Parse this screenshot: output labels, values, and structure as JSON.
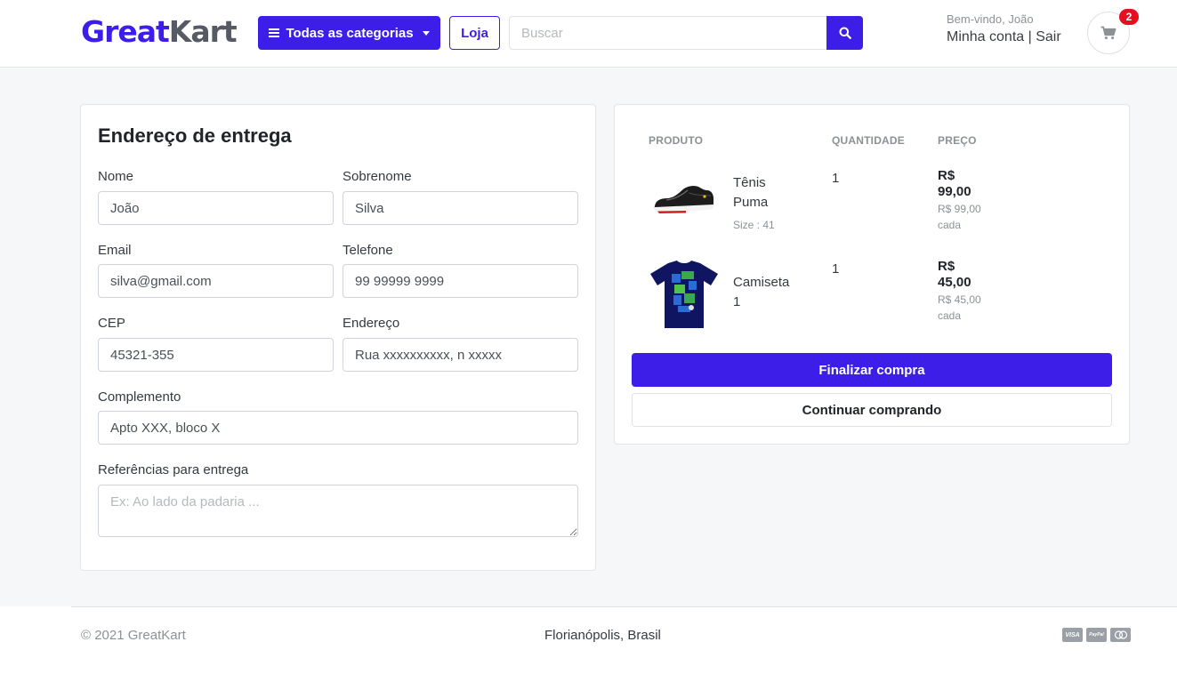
{
  "header": {
    "logo_part1": "Great",
    "logo_part2": "Kart",
    "categories_label": "Todas as categorias",
    "store_label": "Loja",
    "search_placeholder": "Buscar",
    "welcome_text": "Bem-vindo, João",
    "my_account_label": "Minha conta",
    "separator": "|",
    "logout_label": "Sair",
    "cart_count": "2"
  },
  "shipping_form": {
    "title": "Endereço de entrega",
    "first_name": {
      "label": "Nome",
      "value": "João"
    },
    "last_name": {
      "label": "Sobrenome",
      "value": "Silva"
    },
    "email": {
      "label": "Email",
      "value": "silva@gmail.com"
    },
    "phone": {
      "label": "Telefone",
      "value": "99 99999 9999"
    },
    "zip": {
      "label": "CEP",
      "value": "45321-355"
    },
    "address": {
      "label": "Endereço",
      "value": "Rua xxxxxxxxxx, n xxxxx"
    },
    "complement": {
      "label": "Complemento",
      "value": "Apto XXX, bloco X"
    },
    "references": {
      "label": "Referências para entrega",
      "placeholder": "Ex: Ao lado da padaria ..."
    }
  },
  "cart": {
    "columns": {
      "product": "PRODUTO",
      "quantity": "QUANTIDADE",
      "price": "PREÇO"
    },
    "items": [
      {
        "name_line1": "Tênis",
        "name_line2": "Puma",
        "variation": "Size : 41",
        "quantity": "1",
        "total_line1": "R$",
        "total_line2": "99,00",
        "unit_line1": "R$ 99,00",
        "unit_line2": "cada"
      },
      {
        "name_line1": "Camiseta",
        "name_line2": "1",
        "variation": "",
        "quantity": "1",
        "total_line1": "R$",
        "total_line2": "45,00",
        "unit_line1": "R$ 45,00",
        "unit_line2": "cada"
      }
    ],
    "checkout_label": "Finalizar compra",
    "continue_label": "Continuar comprando"
  },
  "footer": {
    "copyright": "© 2021 GreatKart",
    "location": "Florianópolis, Brasil",
    "payment_icons": [
      "visa-icon",
      "paypal-icon",
      "mastercard-icon"
    ],
    "payment_labels": [
      "VISA",
      "PayPal"
    ]
  },
  "colors": {
    "accent": "#3d1ee8",
    "badge": "#e4101f",
    "background": "#f6f7f9"
  }
}
